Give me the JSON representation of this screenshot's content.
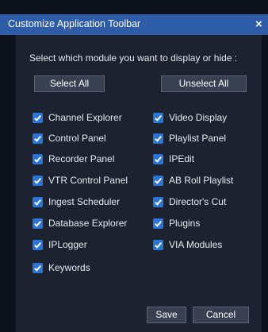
{
  "dialog": {
    "title": "Customize Application Toolbar",
    "close_label": "×",
    "instruction": "Select which module you want to display or hide :",
    "select_all_label": "Select All",
    "unselect_all_label": "Unselect All",
    "save_label": "Save",
    "cancel_label": "Cancel"
  },
  "modules": {
    "left": [
      {
        "label": "Channel Explorer",
        "checked": true
      },
      {
        "label": "Control Panel",
        "checked": true
      },
      {
        "label": "Recorder Panel",
        "checked": true
      },
      {
        "label": "VTR Control Panel",
        "checked": true
      },
      {
        "label": "Ingest Scheduler",
        "checked": true
      },
      {
        "label": "Database Explorer",
        "checked": true
      },
      {
        "label": "IPLogger",
        "checked": true
      },
      {
        "label": "Keywords",
        "checked": true
      }
    ],
    "right": [
      {
        "label": "Video Display",
        "checked": true
      },
      {
        "label": "Playlist Panel",
        "checked": true
      },
      {
        "label": "IPEdit",
        "checked": true
      },
      {
        "label": "AB Roll Playlist",
        "checked": true
      },
      {
        "label": "Director's Cut",
        "checked": true
      },
      {
        "label": "Plugins",
        "checked": true
      },
      {
        "label": "VIA Modules",
        "checked": true
      }
    ]
  },
  "colors": {
    "titlebar": "#2f5ca6",
    "background": "#1c2230",
    "checkbox": "#2a74d8"
  }
}
